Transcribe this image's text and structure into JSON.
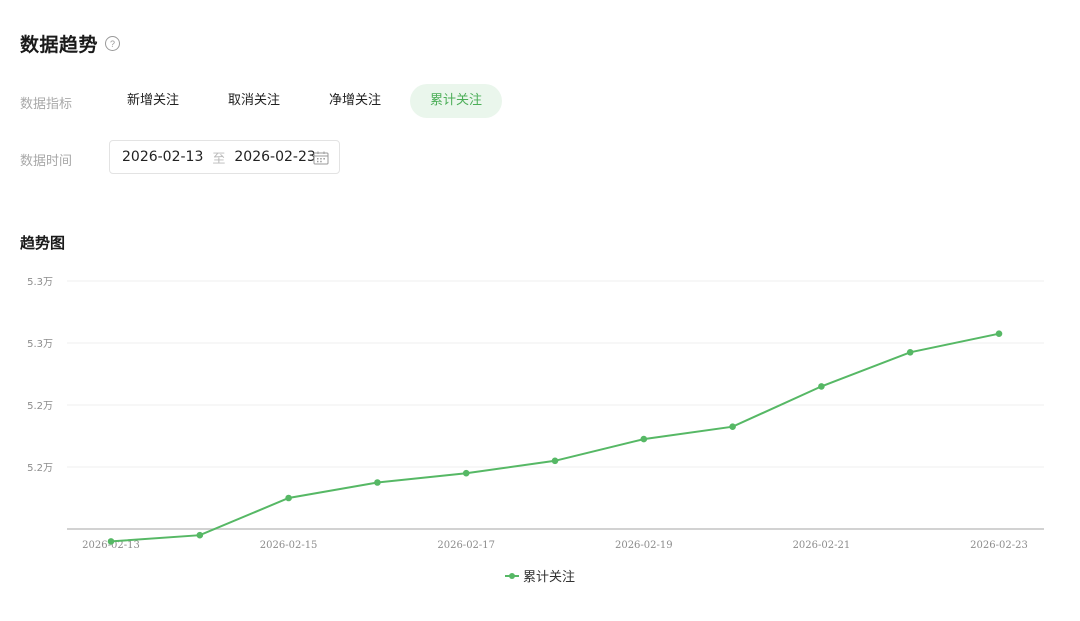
{
  "header": {
    "title": "数据趋势",
    "help_icon": "question-circle-icon"
  },
  "metric_row": {
    "label": "数据指标",
    "tabs": [
      {
        "label": "新增关注",
        "active": false
      },
      {
        "label": "取消关注",
        "active": false
      },
      {
        "label": "净增关注",
        "active": false
      },
      {
        "label": "累计关注",
        "active": true
      }
    ]
  },
  "time_row": {
    "label": "数据时间",
    "start_date": "2026-02-13",
    "separator": "至",
    "end_date": "2026-02-23",
    "icon": "calendar-icon"
  },
  "colors": {
    "accent": "#56b865",
    "active_tab_bg": "#eaf6ec"
  },
  "chart_data": {
    "type": "line",
    "title": "趋势图",
    "x": [
      "2026-02-13",
      "2026-02-14",
      "2026-02-15",
      "2026-02-16",
      "2026-02-17",
      "2026-02-18",
      "2026-02-19",
      "2026-02-20",
      "2026-02-21",
      "2026-02-22",
      "2026-02-23"
    ],
    "x_tick_labels": [
      "2026-02-13",
      "2026-02-15",
      "2026-02-17",
      "2026-02-19",
      "2026-02-21",
      "2026-02-23"
    ],
    "y_tick_labels": [
      "5.3万",
      "5.3万",
      "5.2万",
      "5.2万"
    ],
    "series": [
      {
        "name": "累计关注",
        "values": [
          52460,
          52470,
          52530,
          52555,
          52570,
          52590,
          52625,
          52645,
          52710,
          52765,
          52795
        ]
      }
    ],
    "ylim": [
      52480,
      52880
    ],
    "y_ticks": [
      52880,
      52780,
      52680,
      52580
    ],
    "grid": true,
    "legend": "bottom-center"
  }
}
